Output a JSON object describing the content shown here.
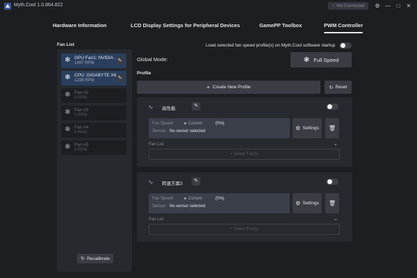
{
  "window": {
    "title": "Myth.Cool 1.0.864.822",
    "connection_status": "Not Connected"
  },
  "tabs": [
    {
      "label": "Hardware Information",
      "active": false
    },
    {
      "label": "LCD Display Settings for Peripheral Devices",
      "active": false
    },
    {
      "label": "GamePP Toolbox",
      "active": false
    },
    {
      "label": "PWM Controller",
      "active": true
    }
  ],
  "fan_list": {
    "title": "Fan List",
    "items": [
      {
        "name": "GPU Fan1: NVIDIA ...",
        "rpm": "1497 RPM",
        "active": true
      },
      {
        "name": "CPU: GIGABYTE X6...",
        "rpm": "1238 RPM",
        "active": true
      },
      {
        "name": "Fan #2",
        "rpm": "0 RPM",
        "active": false
      },
      {
        "name": "Fan #3",
        "rpm": "0 RPM",
        "active": false
      },
      {
        "name": "Fan #4",
        "rpm": "0 RPM",
        "active": false
      },
      {
        "name": "Fan #5",
        "rpm": "0 RPM",
        "active": false
      }
    ],
    "recalibrate_label": "Recalibrate"
  },
  "startup": {
    "label": "Load selected fan speed profile(s) on Myth.Cool software startup",
    "enabled": false
  },
  "global_mode": {
    "label": "Global Mode:",
    "button_label": "Full Speed"
  },
  "profile": {
    "title": "Profile",
    "new_profile_label": "Create New Profile",
    "reset_label": "Reset"
  },
  "profiles": [
    {
      "name": "高性能",
      "enabled": false,
      "fan_speed_label": "Fan Speed:",
      "current_label": "Current",
      "current_value": "(0%)",
      "sensor_label": "Sensor:",
      "sensor_value": "No sensor selected",
      "settings_label": "Settings",
      "fan_list_label": "Fan List",
      "select_fan_label": "+ Select Fan(s)"
    },
    {
      "name": "转速方案3",
      "enabled": false,
      "fan_speed_label": "Fan Speed:",
      "current_label": "Current",
      "current_value": "(0%)",
      "sensor_label": "Sensor:",
      "sensor_value": "No sensor selected",
      "settings_label": "Settings",
      "fan_list_label": "Fan List",
      "select_fan_label": "+ Select Fan(s)"
    }
  ],
  "colors": {
    "background": "#1c1e22",
    "panel": "#26292e",
    "button": "#3a3d43",
    "active_fan": "#2a3f5e"
  }
}
